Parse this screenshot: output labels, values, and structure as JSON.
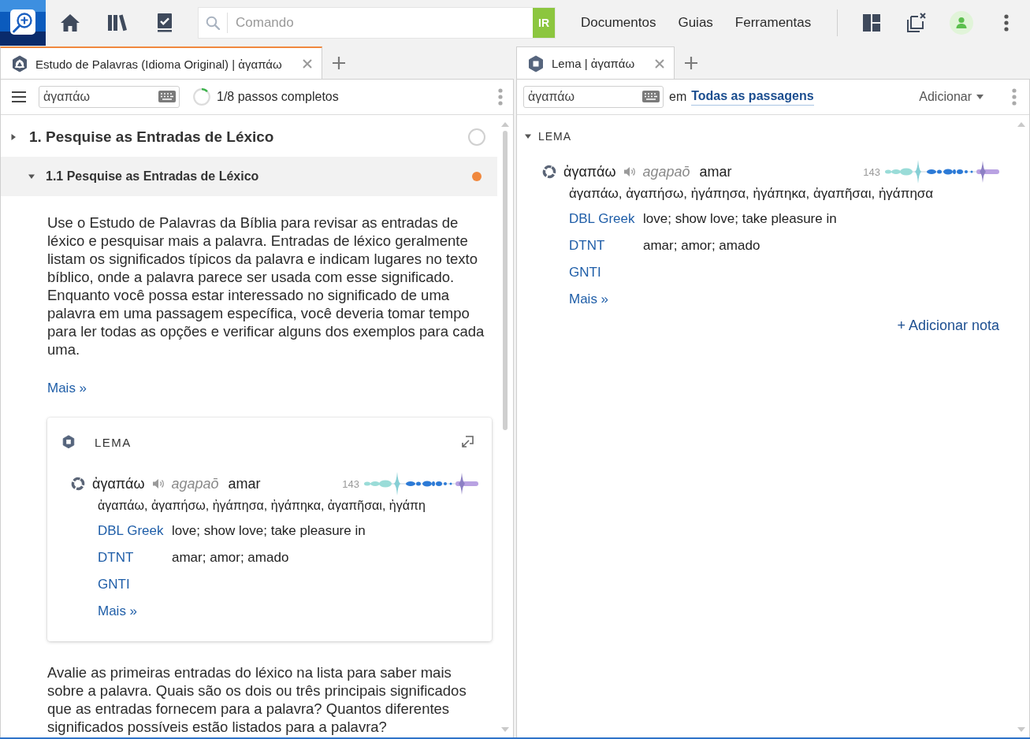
{
  "top_bar": {
    "command": {
      "placeholder": "Comando",
      "go_button": "IR"
    },
    "menus": [
      "Documentos",
      "Guias",
      "Ferramentas"
    ]
  },
  "left_panel": {
    "tab": {
      "title": "Estudo de Palavras (Idioma Original) | ἀγαπάω",
      "selected": true,
      "focused": true
    },
    "search": {
      "value": "ἀγαπάω"
    },
    "progress": {
      "label": "1/8 passos completos",
      "level": 0.125
    },
    "steps": [
      {
        "label": "1. Pesquise as Entradas de Léxico",
        "expanded": false,
        "selected": false,
        "in_progress": false,
        "children": [
          {
            "label": "1.1 Pesquise as Entradas de Léxico",
            "expanded": true,
            "selected": true,
            "in_progress": true,
            "content": [
              {
                "kind": "paragraph",
                "text": "Use o Estudo de Palavras da Bíblia para revisar as entradas de léxico e pesquisar mais a palavra. Entradas de léxico geralmente listam os significados típicos da palavra e indicam lugares no texto bíblico, onde a palavra parece ser usada com esse significado. Enquanto você possa estar interessado no significado de uma palavra em uma passagem específica, você deveria tomar tempo para ler todas as opções e verificar alguns dos exemplos para cada uma."
              },
              {
                "kind": "link",
                "text": "Mais »"
              },
              {
                "kind": "lemma_card",
                "heading": "LEMA",
                "entry": {
                  "lemma": "ἀγαπάω",
                  "transliteration": "agapaō",
                  "gloss": "amar",
                  "count": "143",
                  "forms": "ἀγαπάω, ἀγαπήσω, ἠγάπησα, ἠγάπηκα, ἀγαπῆσαι, ἠγάπη",
                  "definitions": [
                    {
                      "source": "DBL Greek",
                      "text": "love; show love; take pleasure in"
                    },
                    {
                      "source": "DTNT",
                      "text": "amar; amor; amado"
                    },
                    {
                      "source": "GNTI"
                    }
                  ],
                  "more": "Mais »"
                }
              },
              {
                "kind": "paragraph",
                "text": "Avalie as primeiras entradas do léxico na lista para saber mais sobre a palavra. Quais são os dois ou três principais significados que as entradas fornecem para a palavra? Quantos diferentes significados possíveis estão listados para a palavra?"
              }
            ]
          }
        ]
      }
    ]
  },
  "right_panel": {
    "tab": {
      "title": "Lema | ἀγαπάω",
      "selected": true,
      "focused": false
    },
    "search": {
      "value": "ἀγαπάω"
    },
    "scope_label": "em",
    "scope": "Todas as passagens",
    "add_menu": "Adicionar",
    "section": {
      "heading": "LEMA",
      "expanded": true,
      "entry": {
        "lemma": "ἀγαπάω",
        "transliteration": "agapaō",
        "gloss": "amar",
        "count": "143",
        "forms": "ἀγαπάω, ἀγαπήσω, ἠγάπησα, ἠγάπηκα, ἀγαπῆσαι, ἠγάπησα",
        "definitions": [
          {
            "source": "DBL Greek",
            "text": "love; show love; take pleasure in"
          },
          {
            "source": "DTNT",
            "text": "amar; amor; amado"
          },
          {
            "source": "GNTI"
          }
        ],
        "more": "Mais »"
      },
      "add_note": "+ Adicionar nota"
    }
  }
}
